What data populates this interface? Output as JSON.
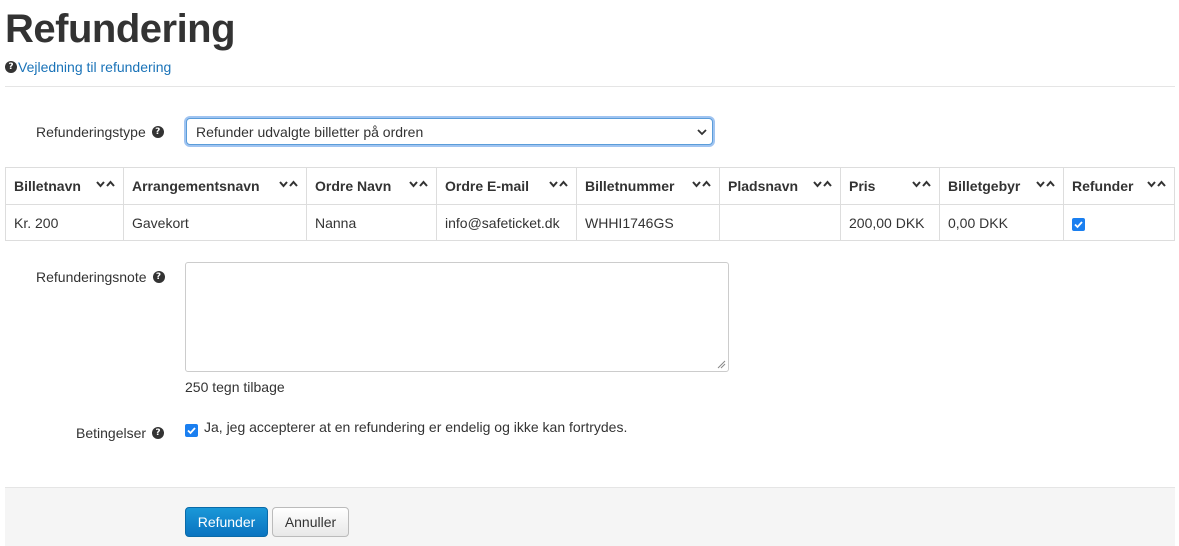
{
  "page": {
    "title": "Refundering",
    "guide_link": "Vejledning til refundering"
  },
  "refund_type": {
    "label": "Refunderingstype",
    "selected": "Refunder udvalgte billetter på ordren"
  },
  "table": {
    "columns": [
      "Billetnavn",
      "Arrangementsnavn",
      "Ordre Navn",
      "Ordre E-mail",
      "Billetnummer",
      "Pladsnavn",
      "Pris",
      "Billetgebyr",
      "Refunder"
    ],
    "rows": [
      {
        "billetnavn": "Kr. 200",
        "arrangementsnavn": "Gavekort",
        "ordre_navn": "Nanna",
        "ordre_email": "info@safeticket.dk",
        "billetnummer": "WHHI1746GS",
        "pladsnavn": "",
        "pris": "200,00 DKK",
        "billetgebyr": "0,00 DKK",
        "refunder": true
      }
    ]
  },
  "note": {
    "label": "Refunderingsnote",
    "value": "",
    "counter": "250 tegn tilbage"
  },
  "terms": {
    "label": "Betingelser",
    "text": "Ja, jeg accepterer at en refundering er endelig og ikke kan fortrydes.",
    "checked": true
  },
  "buttons": {
    "submit": "Refunder",
    "cancel": "Annuller"
  },
  "colors": {
    "link": "#1a73b8",
    "primary": "#0a73c0",
    "checkbox": "#1a7ff0"
  },
  "icons": {
    "help": "question-circle-icon",
    "sort_down": "chevron-down-icon",
    "sort_up": "chevron-up-icon"
  }
}
